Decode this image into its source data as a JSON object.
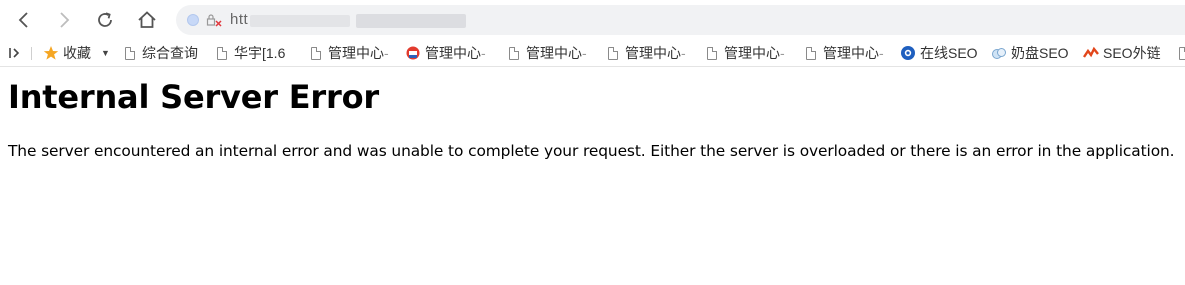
{
  "toolbar": {
    "back_icon": "chevron-left-icon",
    "forward_icon": "chevron-right-icon",
    "reload_icon": "reload-icon",
    "home_icon": "home-icon",
    "address_url": "htt"
  },
  "bookmarks": {
    "items": [
      {
        "label": "收藏",
        "icon": "star-icon"
      },
      {
        "label": "综合查询",
        "icon": "page-icon"
      },
      {
        "label": "华宇[1.6",
        "icon": "page-icon"
      },
      {
        "label": "管理中心",
        "icon": "page-icon"
      },
      {
        "label": "管理中心",
        "icon": "colorful-logo-icon"
      },
      {
        "label": "管理中心",
        "icon": "page-icon"
      },
      {
        "label": "管理中心",
        "icon": "page-icon"
      },
      {
        "label": "管理中心",
        "icon": "page-icon"
      },
      {
        "label": "管理中心",
        "icon": "page-icon"
      },
      {
        "label": "在线SEO",
        "icon": "globe-logo-icon"
      },
      {
        "label": "奶盘SEO",
        "icon": "cloud-logo-icon"
      },
      {
        "label": "SEO外链",
        "icon": "red-logo-icon"
      }
    ],
    "fade_suffix": "-"
  },
  "page": {
    "heading": "Internal Server Error",
    "message": "The server encountered an internal error and was unable to complete your request. Either the server is overloaded or there is an error in the application."
  },
  "colors": {
    "address_bar_bg": "#f1f2f4",
    "star": "#f5a623",
    "text": "#000000"
  }
}
